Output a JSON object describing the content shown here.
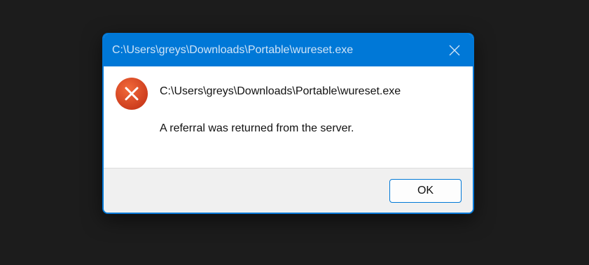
{
  "dialog": {
    "title": "C:\\Users\\greys\\Downloads\\Portable\\wureset.exe",
    "path": "C:\\Users\\greys\\Downloads\\Portable\\wureset.exe",
    "message": "A referral was returned from the server.",
    "ok_label": "OK",
    "close_icon": "close-icon",
    "status_icon": "error-icon"
  },
  "colors": {
    "accent": "#0078d7",
    "title_text": "#cfe4f7",
    "error": "#d84b1e",
    "background": "#1c1c1c",
    "footer": "#f0f0f0"
  }
}
